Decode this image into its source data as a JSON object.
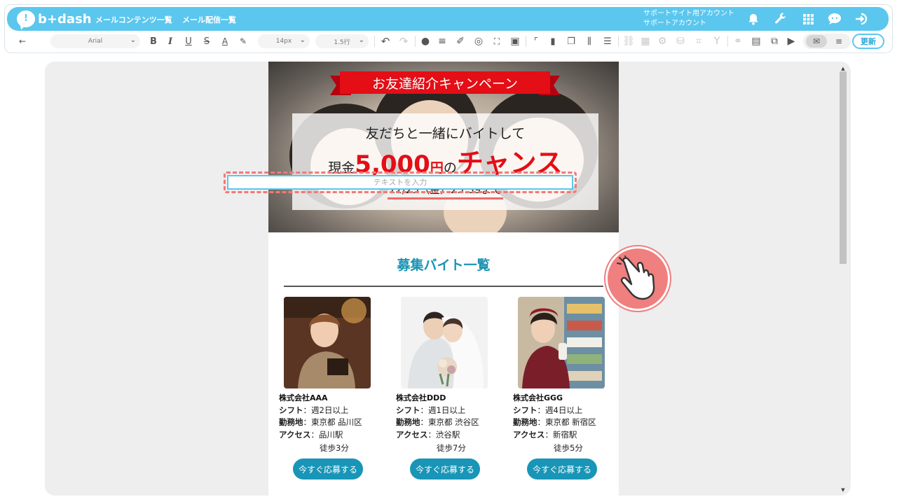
{
  "header": {
    "logo_text": "b+dash",
    "nav": [
      "メールコンテンツ一覧",
      "メール配信一覧"
    ],
    "account_line1": "サポートサイト用アカウント",
    "account_line2": "サポートアカウント",
    "icons": [
      "bell-icon",
      "wrench-icon",
      "grid-icon",
      "support-icon",
      "logout-icon"
    ],
    "brand_color": "#5bc7ee"
  },
  "toolbar": {
    "back_glyph": "←",
    "font_family": "Arial",
    "font_size": "14px",
    "line_height": "1.5行",
    "update_label": "更新"
  },
  "email": {
    "banner": "お友達紹介キャンペーン",
    "line1": "友だちと一緒にバイトして",
    "line2_prefix": "現金",
    "line2_amount": "5,000",
    "line2_yen": "円",
    "line2_no": "の",
    "line2_chance": "チャンス",
    "deadline": "12/25（金）23:59まで",
    "text_placeholder": "テキストを入力",
    "section_title": "募集バイト一覧",
    "accent_red": "#e30e16",
    "accent_teal": "#1895b7"
  },
  "jobs": [
    {
      "company": "株式会社AAA",
      "shift_label": "シフト",
      "shift": "：週2日以上",
      "location_label": "勤務地",
      "location": "：東京都 品川区",
      "access_label": "アクセス",
      "access": "：品川駅",
      "walk": "徒歩3分",
      "button": "今すぐ応募する"
    },
    {
      "company": "株式会社DDD",
      "shift_label": "シフト",
      "shift": "：週1日以上",
      "location_label": "勤務地",
      "location": "：東京都 渋谷区",
      "access_label": "アクセス",
      "access": "：渋谷駅",
      "walk": "徒歩7分",
      "button": "今すぐ応募する"
    },
    {
      "company": "株式会社GGG",
      "shift_label": "シフト",
      "shift": "：週4日以上",
      "location_label": "勤務地",
      "location": "：東京都 新宿区",
      "access_label": "アクセス",
      "access": "：新宿駅",
      "walk": "徒歩5分",
      "button": "今すぐ応募する"
    }
  ]
}
